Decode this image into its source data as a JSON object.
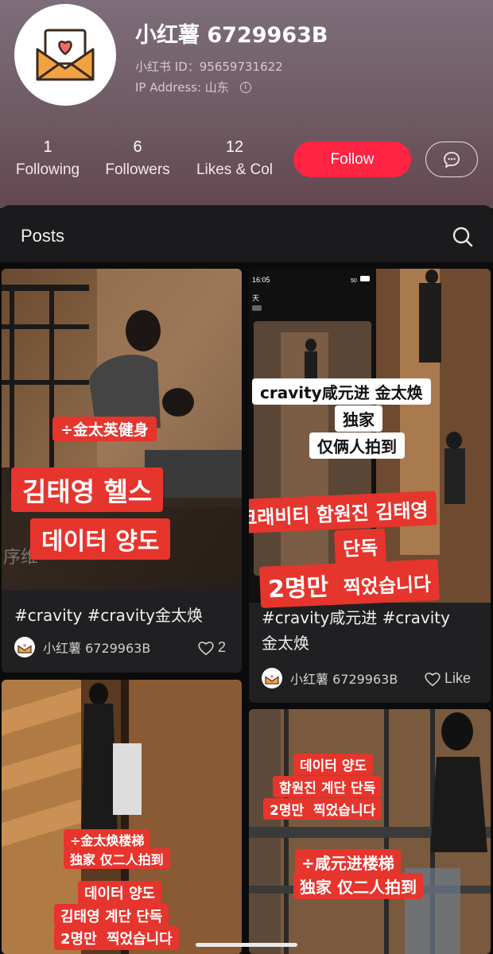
{
  "profile": {
    "username": "小红薯 6729963B",
    "id_line": "小红书 ID：95659731622",
    "ip_line": "IP Address: 山东",
    "info_icon": "i",
    "stats": [
      {
        "value": "1",
        "label": "Following"
      },
      {
        "value": "6",
        "label": "Followers"
      },
      {
        "value": "12",
        "label": "Likes & Col"
      }
    ],
    "follow_label": "Follow",
    "accent": "#ff2442"
  },
  "posts_header": {
    "title": "Posts"
  },
  "posts": [
    {
      "title": "#cravity #cravity金太焕",
      "author": "小红薯 6729963B",
      "likes": "2",
      "overlay": {
        "tag1": "÷金太英健身",
        "line1": "김태영 헬스",
        "line2": "데이터 양도",
        "watermark": "序维"
      }
    },
    {
      "title_line1": "#cravity咸元进 #cravity",
      "title_line2": "金太焕",
      "author": "小红薯 6729963B",
      "likes": "Like",
      "overlay": {
        "phone_time": "16:05",
        "phone_status": "50",
        "phone_day": "天",
        "white1": "cravity咸元进 金太焕",
        "white2": "独家",
        "white3": "仅俩人拍到",
        "red1": "크래비티 함원진 김태영",
        "red2": "단독",
        "red3a": "2명만",
        "red3b": "찍었습니다"
      }
    },
    {
      "overlay": {
        "a1": "÷金太焕楼梯",
        "a2": "独家 仅二人拍到",
        "b1": "데이터 양도",
        "b2": "김태영 계단 단독",
        "b3a": "2명만",
        "b3b": "찍었습니다"
      }
    },
    {
      "overlay": {
        "a1": "데이터 양도",
        "a2": "함원진 계단 단독",
        "a3a": "2명만",
        "a3b": "찍었습니다",
        "b1": "÷咸元进楼梯",
        "b2": "独家 仅二人拍到"
      }
    }
  ]
}
